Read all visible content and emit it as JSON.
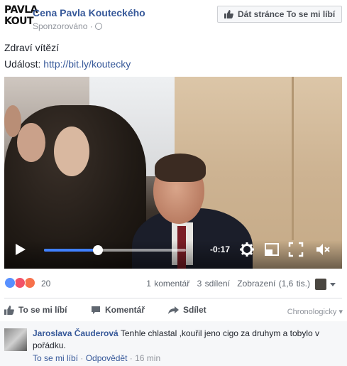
{
  "header": {
    "logo_lines": [
      "PAVLA",
      "KOUT"
    ],
    "page_name": "Cena Pavla Kouteckého",
    "sponsored": "Sponzorováno ·",
    "like_page_button": "Dát stránce To se mi líbí"
  },
  "post": {
    "text": "Zdraví vítězí",
    "event_label": "Událost:",
    "event_link": "http://bit.ly/koutecky"
  },
  "video": {
    "time_remaining": "-0:17",
    "progress_fraction": 0.38
  },
  "reactions": {
    "icons": [
      "like-icon",
      "love-icon",
      "angry-icon"
    ],
    "colors": {
      "like": "#5890ff",
      "love": "#f25268",
      "angry": "#f7714b"
    },
    "count": "20",
    "comments": "1 komentář",
    "shares": "3 sdílení",
    "views": "Zobrazení (1,6 tis.)"
  },
  "actions": {
    "like": "To se mi líbí",
    "comment": "Komentář",
    "share": "Sdílet",
    "sort": "Chronologicky ▾"
  },
  "comment": {
    "author": "Jaroslava Čauderová",
    "text": "Tenhle chlastal ,kouřil jeno cigo za druhym a tobylo v pořádku.",
    "like": "To se mi líbí",
    "separator": "·",
    "reply": "Odpovědět",
    "time": "· 16 min"
  },
  "colors": {
    "link": "#365899",
    "accent": "#4080ff",
    "muted": "#90949c"
  }
}
